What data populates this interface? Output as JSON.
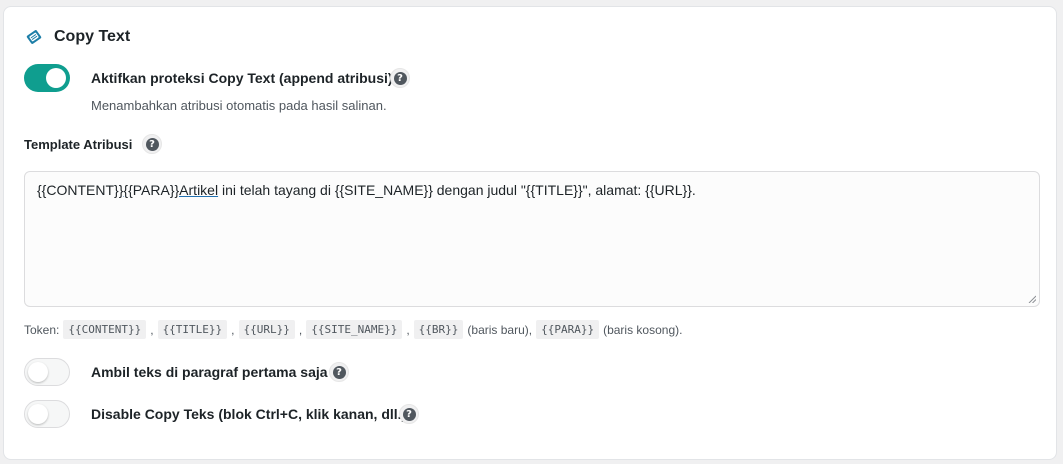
{
  "section": {
    "title": "Copy Text",
    "icon": "copy-protection-icon"
  },
  "enable_toggle": {
    "label": "Aktifkan proteksi Copy Text (append atribusi)",
    "description": "Menambahkan atribusi otomatis pada hasil salinan.",
    "on": true
  },
  "template": {
    "label": "Template Atribusi",
    "parts": [
      "{{CONTENT}",
      "}{",
      "{PARA}",
      "}Artikel",
      " ini telah tayang di {{SITE_NAME}} dengan judul \"{{TITLE}}\", alamat: {{URL}}."
    ]
  },
  "tokens": {
    "prefix": "Token:",
    "items": [
      "{{CONTENT}}",
      "{{TITLE}}",
      "{{URL}}",
      "{{SITE_NAME}}",
      "{{BR}}",
      "{{PARA}}"
    ],
    "separator": ",",
    "br_note": "(baris baru),",
    "para_note": "(baris kosong)."
  },
  "first_paragraph_toggle": {
    "label": "Ambil teks di paragraf pertama saja",
    "on": false
  },
  "disable_copy_toggle": {
    "label": "Disable Copy Teks (blok Ctrl+C, klik kanan, dll.)",
    "on": false
  },
  "help_glyph": "?",
  "colors": {
    "accent": "#0f9e8f",
    "text": "#1d2327",
    "muted": "#50575e"
  }
}
